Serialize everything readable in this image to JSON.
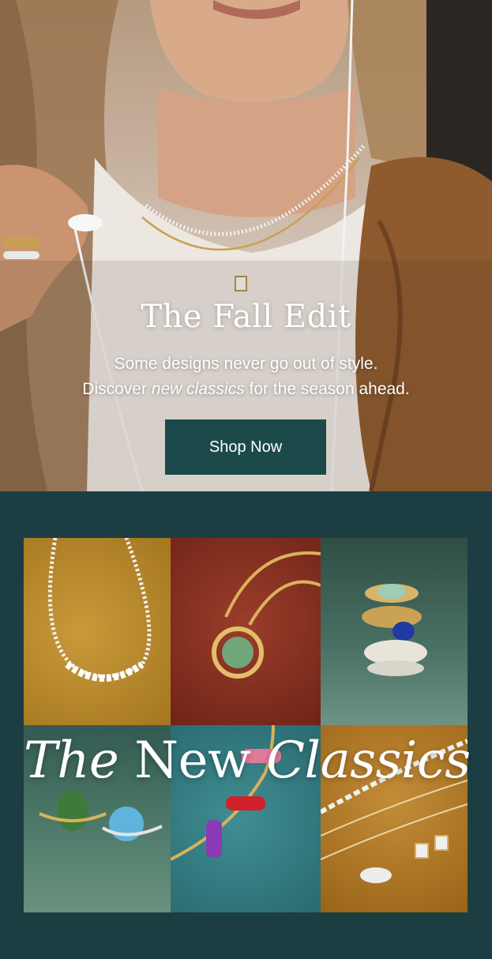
{
  "hero": {
    "title": "The Fall Edit",
    "subtitle_line1": "Some designs never go out of style.",
    "subtitle_line2_prefix": "Discover ",
    "subtitle_line2_italic": "new classics",
    "subtitle_line2_suffix": " for the season ahead.",
    "cta_label": "Shop Now"
  },
  "classics": {
    "title_word1": "The",
    "title_word2": "New",
    "title_word3": "Classics"
  },
  "colors": {
    "brand_teal": "#1c4a4a",
    "section_bg": "#1c3e42"
  }
}
